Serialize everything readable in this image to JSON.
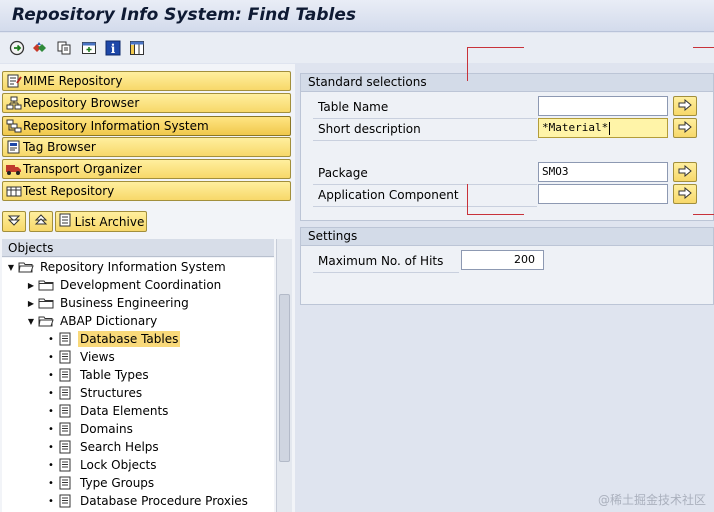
{
  "window": {
    "title": "Repository Info System: Find Tables"
  },
  "toolbar": {
    "icons": [
      "execute-icon",
      "other-object-icon",
      "copy-icon",
      "new-window-icon",
      "info-icon",
      "layout-icon"
    ]
  },
  "nav": {
    "buttons": [
      {
        "label": "MIME Repository",
        "icon": "mime-icon"
      },
      {
        "label": "Repository Browser",
        "icon": "hierarchy-icon"
      },
      {
        "label": "Repository Information System",
        "icon": "hierarchy-icon"
      },
      {
        "label": "Tag Browser",
        "icon": "tag-icon"
      },
      {
        "label": "Transport Organizer",
        "icon": "truck-icon"
      },
      {
        "label": "Test Repository",
        "icon": "test-icon"
      }
    ],
    "collapse_icon": "collapse-icon",
    "expand_icon": "expand-icon",
    "list_archive": "List Archive"
  },
  "objects": {
    "header": "Objects",
    "tree": [
      {
        "label": "Repository Information System",
        "level": 0,
        "expanded": true,
        "type": "folder"
      },
      {
        "label": "Development Coordination",
        "level": 1,
        "expanded": false,
        "type": "folder"
      },
      {
        "label": "Business Engineering",
        "level": 1,
        "expanded": false,
        "type": "folder"
      },
      {
        "label": "ABAP Dictionary",
        "level": 1,
        "expanded": true,
        "type": "folder"
      },
      {
        "label": "Database Tables",
        "level": 2,
        "type": "doc",
        "selected": true
      },
      {
        "label": "Views",
        "level": 2,
        "type": "doc"
      },
      {
        "label": "Table Types",
        "level": 2,
        "type": "doc"
      },
      {
        "label": "Structures",
        "level": 2,
        "type": "doc"
      },
      {
        "label": "Data Elements",
        "level": 2,
        "type": "doc"
      },
      {
        "label": "Domains",
        "level": 2,
        "type": "doc"
      },
      {
        "label": "Search Helps",
        "level": 2,
        "type": "doc"
      },
      {
        "label": "Lock Objects",
        "level": 2,
        "type": "doc"
      },
      {
        "label": "Type Groups",
        "level": 2,
        "type": "doc"
      },
      {
        "label": "Database Procedure Proxies",
        "level": 2,
        "type": "doc"
      }
    ]
  },
  "standard_selections": {
    "header": "Standard selections",
    "fields": [
      {
        "label": "Table Name",
        "value": ""
      },
      {
        "label": "Short description",
        "value": "*Material*"
      },
      {
        "label": "Package",
        "value": "SMO3"
      },
      {
        "label": "Application Component",
        "value": ""
      }
    ]
  },
  "settings": {
    "header": "Settings",
    "max_hits_label": "Maximum No. of Hits",
    "max_hits_value": "200"
  },
  "watermark": "@稀土掘金技术社区",
  "colors": {
    "accent_red": "#c8323a",
    "button_yellow": "#f7d86a",
    "selection": "#f9d97a"
  }
}
